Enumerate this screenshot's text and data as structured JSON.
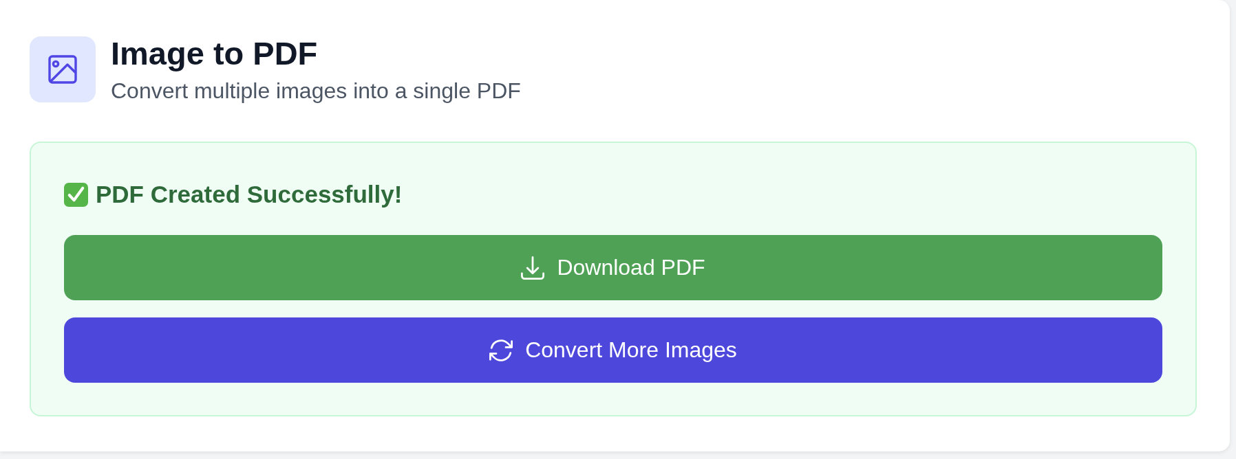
{
  "header": {
    "title": "Image to PDF",
    "subtitle": "Convert multiple images into a single PDF"
  },
  "result": {
    "kind": "success",
    "message": "PDF Created Successfully!",
    "actions": [
      {
        "kind": "download",
        "label": "Download PDF"
      },
      {
        "kind": "restart",
        "label": "Convert More Images"
      }
    ]
  }
}
